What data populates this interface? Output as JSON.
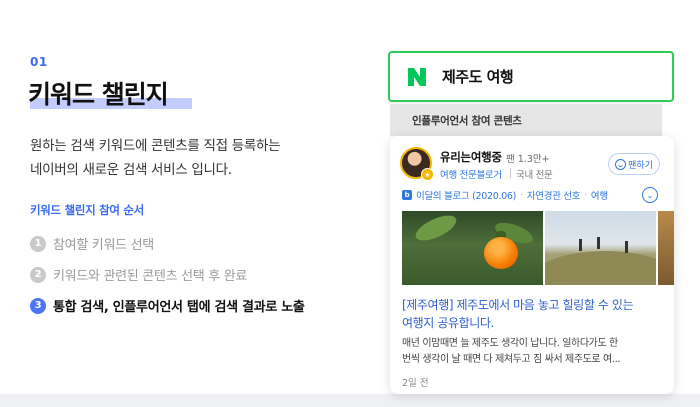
{
  "intro": {
    "step_number": "01",
    "title": "키워드 챌린지",
    "description": [
      "원하는 검색 키워드에 콘텐츠를 직접 등록하는",
      "네이버의 새로운 검색 서비스 입니다."
    ],
    "steps_title": "키워드 챌린지 참여 순서",
    "steps": [
      {
        "num": "1",
        "label": "참여할 키워드 선택",
        "active": false
      },
      {
        "num": "2",
        "label": "키워드와 관련된 콘텐츠 선택 후 완료",
        "active": false
      },
      {
        "num": "3",
        "label": "통합 검색, 인플루어언서 탭에 검색 결과로 노출",
        "active": true
      }
    ]
  },
  "search": {
    "logo": "naver-n-logo",
    "query": "제주도 여행",
    "brand_color": "#2ecc57"
  },
  "influencer_section": {
    "label": "인플루어언서 참여 콘텐츠"
  },
  "card": {
    "user_name": "유리는여행중",
    "fans": "팬 1.3만+",
    "category": "여행 전문블로거",
    "region": "국내 전문",
    "fan_button": "팬하기",
    "tags": [
      "이달의 블로그 (2020.06)",
      "자연경관 선호",
      "여행"
    ],
    "post_title": [
      "[제주여행] 제주도에서 마음 놓고 힐링할 수 있는",
      "여행지 공유합니다."
    ],
    "post_body": [
      "매년 이맘때면 늘 제주도 생각이 납니다. 일하다가도 한",
      "번씩 생각이 날 때면 다 제쳐두고 짐 싸서 제주도로 여..."
    ],
    "post_time": "2일 전",
    "accent_color": "#2f76e0"
  }
}
